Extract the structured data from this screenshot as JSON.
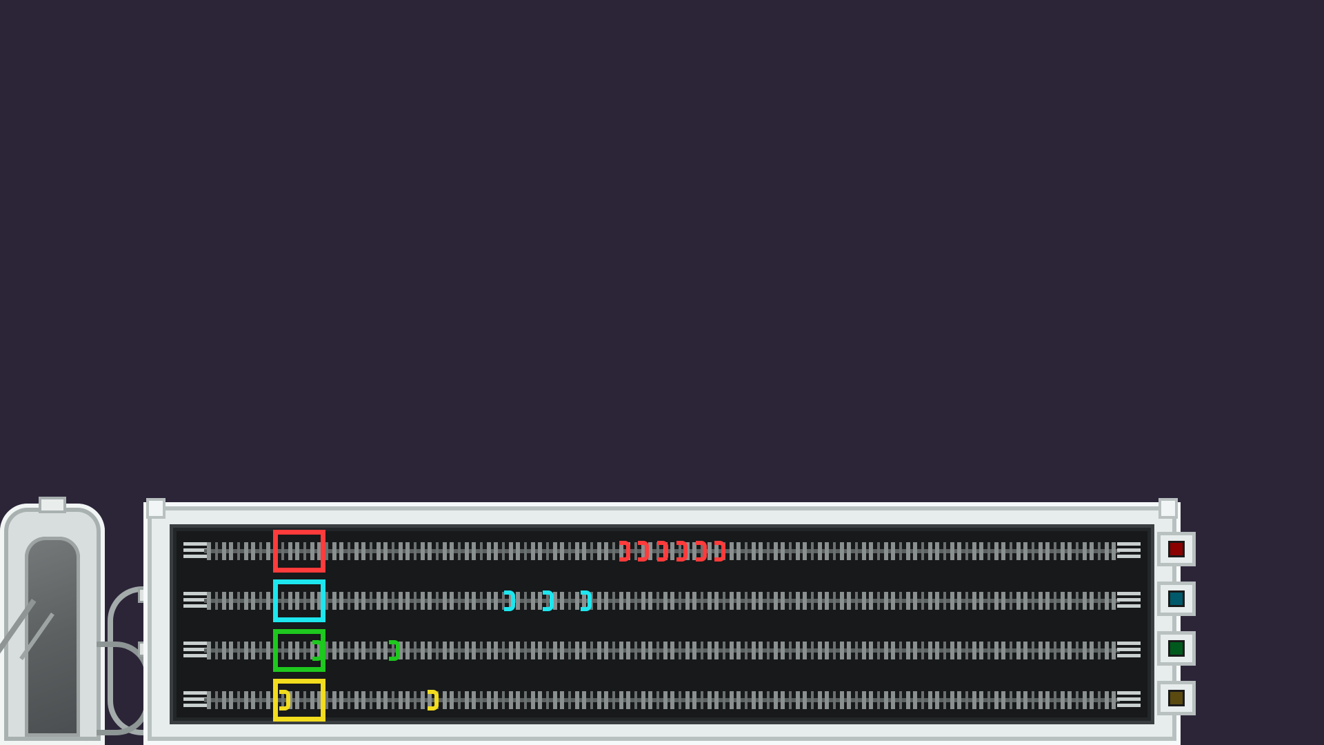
{
  "lanes": [
    {
      "id": "red",
      "color": "#ff3b3b",
      "indicator_color": "#8b0000",
      "notes": [
        0.455,
        0.475,
        0.495,
        0.515,
        0.535,
        0.555
      ]
    },
    {
      "id": "cyan",
      "color": "#1ee6ee",
      "indicator_color": "#005a6b",
      "notes": [
        0.335,
        0.375,
        0.415
      ]
    },
    {
      "id": "green",
      "color": "#1ec81e",
      "indicator_color": "#005a1e",
      "notes": [
        0.135,
        0.215
      ]
    },
    {
      "id": "yellow",
      "color": "#f2dc1e",
      "indicator_color": "#5a4a10",
      "notes": [
        0.1,
        0.255
      ]
    }
  ],
  "icons": {
    "pillar": "capsule-pillar-icon",
    "board": "rhythm-board"
  }
}
